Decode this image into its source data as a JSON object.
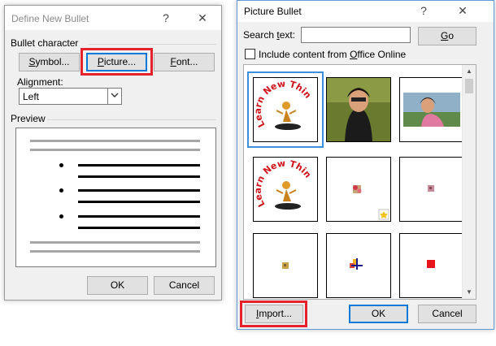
{
  "define_dialog": {
    "title": "Define New Bullet",
    "help": "?",
    "close": "✕",
    "bullet_character_label": "Bullet character",
    "symbol_button": {
      "pre": "",
      "key": "S",
      "post": "ymbol..."
    },
    "picture_button": {
      "pre": "",
      "key": "P",
      "post": "icture..."
    },
    "font_button": {
      "pre": "",
      "key": "F",
      "post": "ont..."
    },
    "alignment_label": {
      "pre": "Ali",
      "key": "g",
      "post": "nment:"
    },
    "alignment_value": "Left",
    "preview_label": "Preview",
    "ok_label": "OK",
    "cancel_label": "Cancel"
  },
  "picture_dialog": {
    "title": "Picture Bullet",
    "help": "?",
    "close": "✕",
    "search_label": {
      "pre": "Search ",
      "key": "t",
      "post": "ext:"
    },
    "search_value": "",
    "go_button": {
      "pre": "",
      "key": "G",
      "post": "o"
    },
    "include_label": {
      "pre": "Include content from ",
      "key": "O",
      "post": "ffice Online"
    },
    "include_checked": false,
    "gallery_items": [
      "learn-new-things-logo",
      "woman-portrait-photo",
      "woman-outdoor-photo",
      "learn-new-things-logo",
      "small-flower-picture",
      "small-pink-square",
      "small-gold-square",
      "colored-cross",
      "red-square"
    ],
    "import_button": {
      "pre": "",
      "key": "I",
      "post": "mport..."
    },
    "ok_label": "OK",
    "cancel_label": "Cancel"
  },
  "colors": {
    "highlight": "#e4222e",
    "selection": "#3c8fd8"
  }
}
